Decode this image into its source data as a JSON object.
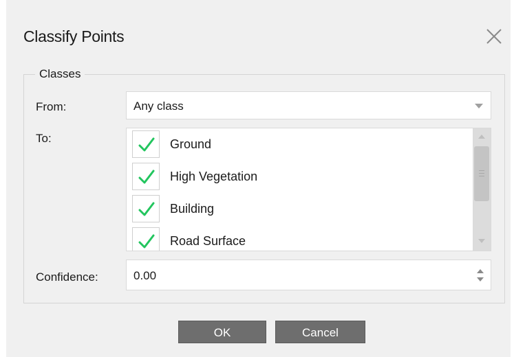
{
  "dialog": {
    "title": "Classify Points"
  },
  "classes_group": {
    "legend": "Classes",
    "from_label": "From:",
    "from_value": "Any class",
    "to_label": "To:",
    "to_items": [
      {
        "label": "Ground",
        "checked": true
      },
      {
        "label": "High Vegetation",
        "checked": true
      },
      {
        "label": "Building",
        "checked": true
      },
      {
        "label": "Road Surface",
        "checked": true
      }
    ],
    "confidence_label": "Confidence:",
    "confidence_value": "0.00"
  },
  "buttons": {
    "ok_label": "OK",
    "cancel_label": "Cancel"
  },
  "colors": {
    "checkmark": "#22c55e",
    "button_bg": "#6e6e6e",
    "dialog_bg": "#f0f0f0"
  },
  "icons": {
    "close": "close-icon",
    "check": "checkmark-icon",
    "dropdown": "chevron-down-icon"
  }
}
